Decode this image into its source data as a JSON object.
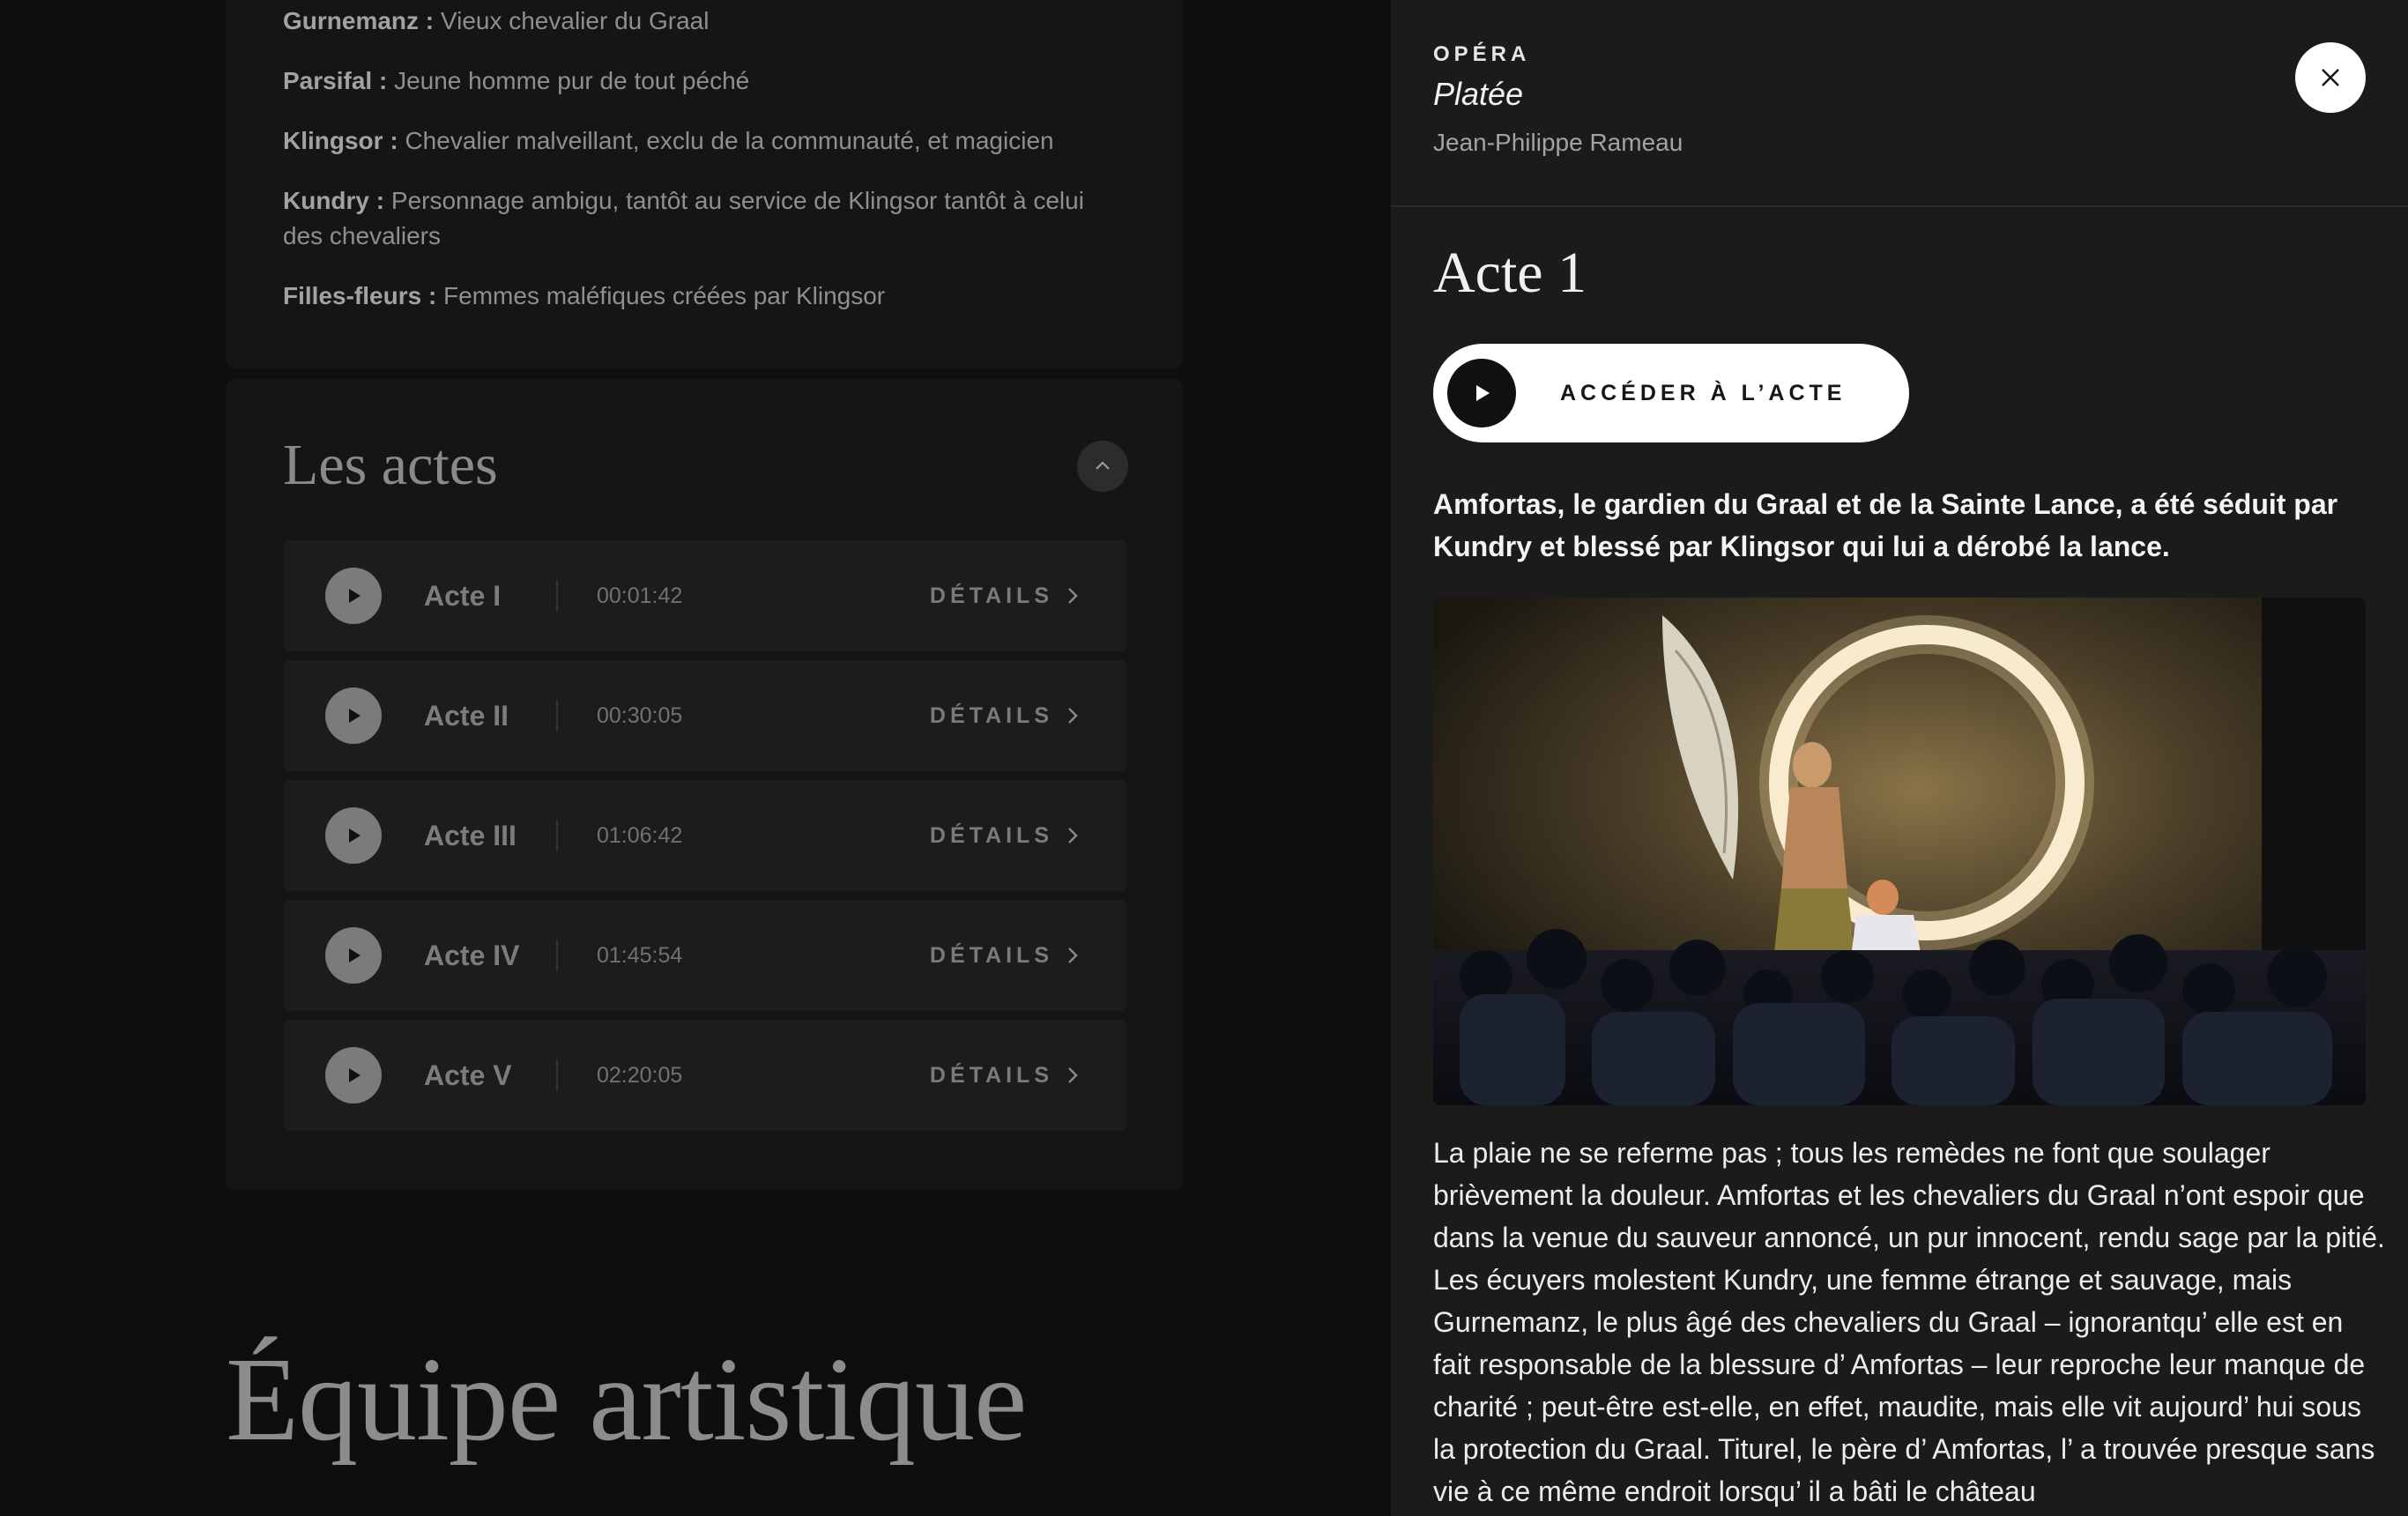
{
  "roles": [
    {
      "name": "Gurnemanz :",
      "desc": "Vieux chevalier du Graal"
    },
    {
      "name": "Parsifal :",
      "desc": "Jeune homme pur de tout péché"
    },
    {
      "name": "Klingsor :",
      "desc": "Chevalier malveillant, exclu de la communauté, et magicien"
    },
    {
      "name": "Kundry :",
      "desc": "Personnage ambigu, tantôt au service de Klingsor tantôt à celui des chevaliers"
    },
    {
      "name": "Filles-fleurs :",
      "desc": "Femmes maléfiques créées par Klingsor"
    }
  ],
  "acts_section": {
    "title": "Les actes",
    "details_label": "DÉTAILS",
    "items": [
      {
        "name": "Acte I",
        "duration": "00:01:42"
      },
      {
        "name": "Acte II",
        "duration": "00:30:05"
      },
      {
        "name": "Acte III",
        "duration": "01:06:42"
      },
      {
        "name": "Acte IV",
        "duration": "01:45:54"
      },
      {
        "name": "Acte V",
        "duration": "02:20:05"
      }
    ]
  },
  "team_title": "Équipe artistique",
  "drawer": {
    "kicker": "OPÉRA",
    "work_title": "Platée",
    "composer": "Jean-Philippe Rameau",
    "act_heading": "Acte 1",
    "access_label": "ACCÉDER À L’ACTE",
    "lead": "Amfortas, le gardien du Graal et de la Sainte Lance, a été séduit par Kundry et blessé par Klingsor qui lui a dérobé la lance.",
    "body": "La plaie ne se referme pas ; tous les remèdes ne font que soulager brièvement la douleur. Amfortas et les chevaliers du Graal n’ont espoir que dans la venue du sauveur annoncé, un pur innocent, rendu sage par la pitié. Les écuyers molestent Kundry, une femme étrange et sauvage, mais Gurnemanz, le plus âgé des chevaliers du Graal – ignorantqu’ elle est en fait responsable de la blessure d’ Amfortas – leur reproche leur manque de charité ; peut-être est-elle, en effet, maudite, mais elle vit aujourd’ hui sous la protection du Graal. Titurel, le père d’ Amfortas, l’ a trouvée presque sans vie à ce même endroit lorsqu’ il a bâti le château"
  },
  "icons": {
    "close": "close-icon",
    "play": "play-icon",
    "chevron_up": "chevron-up-icon",
    "chevron_right": "chevron-right-icon"
  },
  "colors": {
    "drawer_bg": "#1b1b1b",
    "page_bg": "#0e0e0e",
    "card_bg": "#151515",
    "accent_button": "#ffffff"
  }
}
